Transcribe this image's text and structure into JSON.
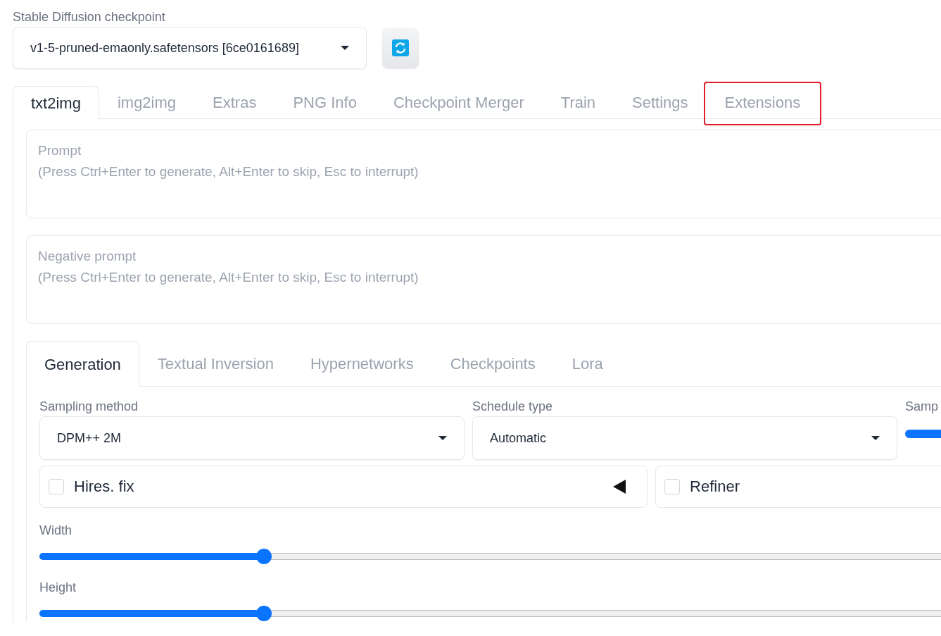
{
  "checkpoint": {
    "label": "Stable Diffusion checkpoint",
    "value": "v1-5-pruned-emaonly.safetensors [6ce0161689]"
  },
  "tabs": [
    {
      "label": "txt2img",
      "selected": true,
      "highlighted": false
    },
    {
      "label": "img2img",
      "selected": false,
      "highlighted": false
    },
    {
      "label": "Extras",
      "selected": false,
      "highlighted": false
    },
    {
      "label": "PNG Info",
      "selected": false,
      "highlighted": false
    },
    {
      "label": "Checkpoint Merger",
      "selected": false,
      "highlighted": false
    },
    {
      "label": "Train",
      "selected": false,
      "highlighted": false
    },
    {
      "label": "Settings",
      "selected": false,
      "highlighted": false
    },
    {
      "label": "Extensions",
      "selected": false,
      "highlighted": true
    }
  ],
  "prompts": [
    {
      "label": "Prompt",
      "placeholder": "(Press Ctrl+Enter to generate, Alt+Enter to skip, Esc to interrupt)"
    },
    {
      "label": "Negative prompt",
      "placeholder": "(Press Ctrl+Enter to generate, Alt+Enter to skip, Esc to interrupt)"
    }
  ],
  "subtabs": [
    {
      "label": "Generation",
      "selected": true
    },
    {
      "label": "Textual Inversion",
      "selected": false
    },
    {
      "label": "Hypernetworks",
      "selected": false
    },
    {
      "label": "Checkpoints",
      "selected": false
    },
    {
      "label": "Lora",
      "selected": false
    }
  ],
  "sampling_method": {
    "label": "Sampling method",
    "value": "DPM++ 2M"
  },
  "schedule_type": {
    "label": "Schedule type",
    "value": "Automatic"
  },
  "sampling_steps": {
    "label": "Samp",
    "level": 1
  },
  "accordions": [
    {
      "label": "Hires. fix",
      "checked": false,
      "expanded": false
    },
    {
      "label": "Refiner",
      "checked": false
    }
  ],
  "sliders": [
    {
      "label": "Width",
      "level": 0.228
    },
    {
      "label": "Height",
      "level": 0.228
    }
  ]
}
